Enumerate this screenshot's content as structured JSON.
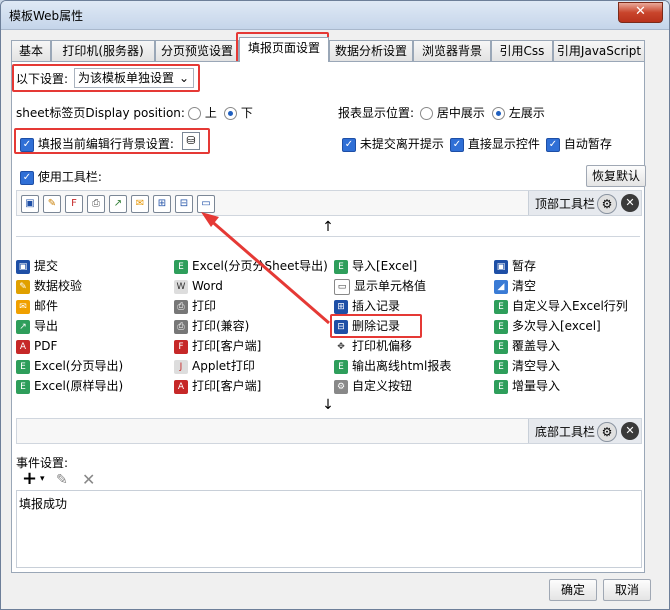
{
  "window": {
    "title": "模板Web属性",
    "close_label": "✕"
  },
  "tabs": [
    {
      "label": "基本"
    },
    {
      "label": "打印机(服务器)"
    },
    {
      "label": "分页预览设置"
    },
    {
      "label": "填报页面设置"
    },
    {
      "label": "数据分析设置"
    },
    {
      "label": "浏览器背景"
    },
    {
      "label": "引用Css"
    },
    {
      "label": "引用JavaScript"
    }
  ],
  "settings": {
    "scope_label": "以下设置:",
    "scope_value": "为该模板单独设置",
    "sheet_tab_label": "sheet标签页Display position:",
    "sheet_tab_options": [
      "上",
      "下"
    ],
    "report_pos_label": "报表显示位置:",
    "report_pos_options": [
      "居中展示",
      "左展示"
    ],
    "bg_label": "填报当前编辑行背景设置:",
    "unsubmitted_label": "未提交离开提示",
    "direct_controls_label": "直接显示控件",
    "autosave_label": "自动暂存",
    "use_toolbar_label": "使用工具栏:",
    "restore_label": "恢复默认"
  },
  "toolbar": {
    "top_label": "顶部工具栏",
    "bottom_label": "底部工具栏",
    "icons": [
      "save-icon",
      "edit-icon",
      "excel-icon",
      "print-icon",
      "export-icon",
      "email-icon",
      "insert-row-icon",
      "delete-row-icon",
      "window-icon"
    ]
  },
  "items": [
    [
      "提交",
      "Excel(分页分Sheet导出)",
      "导入[Excel]",
      "暂存"
    ],
    [
      "数据校验",
      "Word",
      "显示单元格值",
      "清空"
    ],
    [
      "邮件",
      "打印",
      "插入记录",
      "自定义导入Excel行列"
    ],
    [
      "导出",
      "打印(兼容)",
      "删除记录",
      "多次导入[excel]"
    ],
    [
      "PDF",
      "打印[客户端]",
      "打印机偏移",
      "覆盖导入"
    ],
    [
      "Excel(分页导出)",
      "Applet打印",
      "输出离线html报表",
      "清空导入"
    ],
    [
      "Excel(原样导出)",
      "打印[客户端]",
      "自定义按钮",
      "增量导入"
    ]
  ],
  "events": {
    "label": "事件设置:",
    "add_label": "+",
    "entries": [
      "填报成功"
    ]
  },
  "footer": {
    "ok_label": "确定",
    "cancel_label": "取消"
  }
}
